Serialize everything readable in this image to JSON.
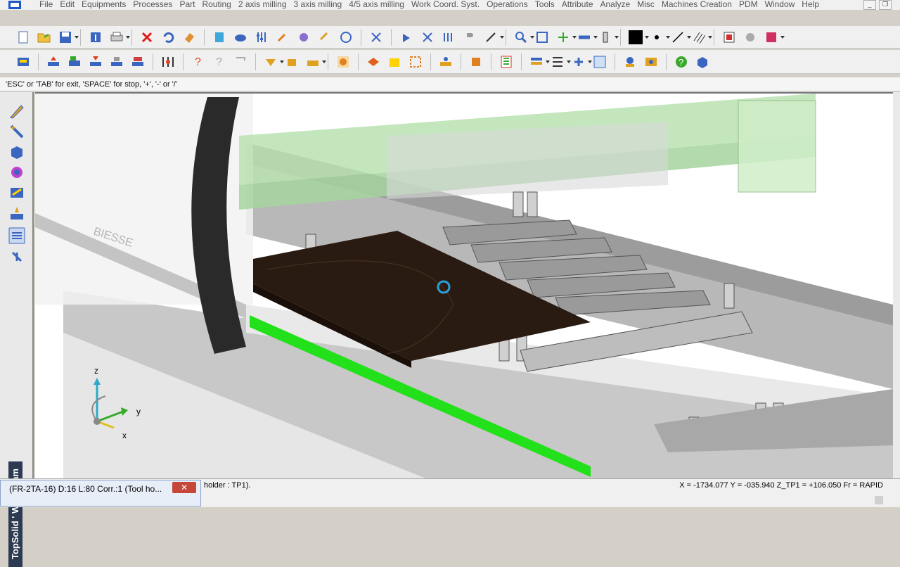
{
  "menubar": {
    "items": [
      "File",
      "Edit",
      "Equipments",
      "Processes",
      "Part",
      "Routing",
      "2 axis milling",
      "3 axis milling",
      "4/5 axis milling",
      "Work Coord. Syst.",
      "Operations",
      "Tools",
      "Attribute",
      "Analyze",
      "Misc",
      "Machines Creation",
      "PDM",
      "Window",
      "Help"
    ],
    "minimize_label": "_",
    "restore_label": "❐"
  },
  "toolbar1": {
    "icons": [
      "new-file",
      "open-folder",
      "save",
      "properties",
      "print",
      "delete",
      "undo",
      "eraser",
      "calculator",
      "cloud",
      "tuning",
      "hammer",
      "mallet",
      "chain",
      "measure",
      "axis-x",
      "sensor",
      "magnet",
      "weld",
      "cursor",
      "zoom",
      "zoom-window",
      "pan",
      "refresh",
      "color-black",
      "point",
      "line",
      "hatch",
      "layer",
      "gear",
      "settings"
    ]
  },
  "toolbar2": {
    "icons": [
      "machine-2",
      "move-up",
      "machine-3",
      "move-down",
      "machine-4",
      "machine-5",
      "grid",
      "help-arrow",
      "query",
      "bracket",
      "fold",
      "bucket",
      "pointer",
      "clock",
      "pallet",
      "box-tools",
      "screen",
      "board",
      "hex",
      "puzzle",
      "layer-stack",
      "list",
      "grid-2",
      "network",
      "compass",
      "settings-2",
      "help",
      "view-3d"
    ]
  },
  "status": {
    "hint": "'ESC' or 'TAB' for exit, 'SPACE' for stop, '+', '-' or '/'",
    "tooltip": "(FR-2TA-16)  D:16  L:80  Corr.:1  (Tool ho...",
    "tooltip_close": "✕",
    "message": "holder : TP1).",
    "coords": "X = -1734.077  Y = -035.940    Z_TP1 = +106.050   Fr = RAPID"
  },
  "brand": "TopSolid ' WoodCam",
  "viewport": {
    "machine_label": "BIESSE",
    "axis_labels": {
      "z": "z",
      "y": "y",
      "x": "x"
    }
  },
  "colors": {
    "board": "#2a1b12",
    "green_strip": "#22e01a",
    "hood_green": "#b9e2b2"
  }
}
